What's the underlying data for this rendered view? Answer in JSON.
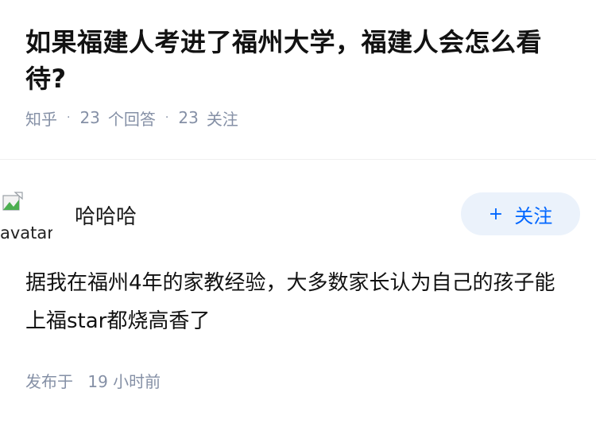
{
  "question": {
    "title": "如果福建人考进了福州大学，福建人会怎么看待?",
    "source": "知乎",
    "answers_count": "23",
    "answers_label": "个回答",
    "followers_count": "23",
    "followers_label": "关注"
  },
  "answer": {
    "avatar_alt": "avatar",
    "author": "哈哈哈",
    "follow_label": "关注",
    "follow_icon": "plus-icon",
    "content": "据我在福州4年的家教经验，大多数家长认为自己的孩子能上福star都烧高香了",
    "published_prefix": "发布于",
    "published_time": "19 小时前"
  },
  "colors": {
    "accent": "#0066ff",
    "follow_bg": "#ebf2fb",
    "meta_text": "#8590a6"
  }
}
